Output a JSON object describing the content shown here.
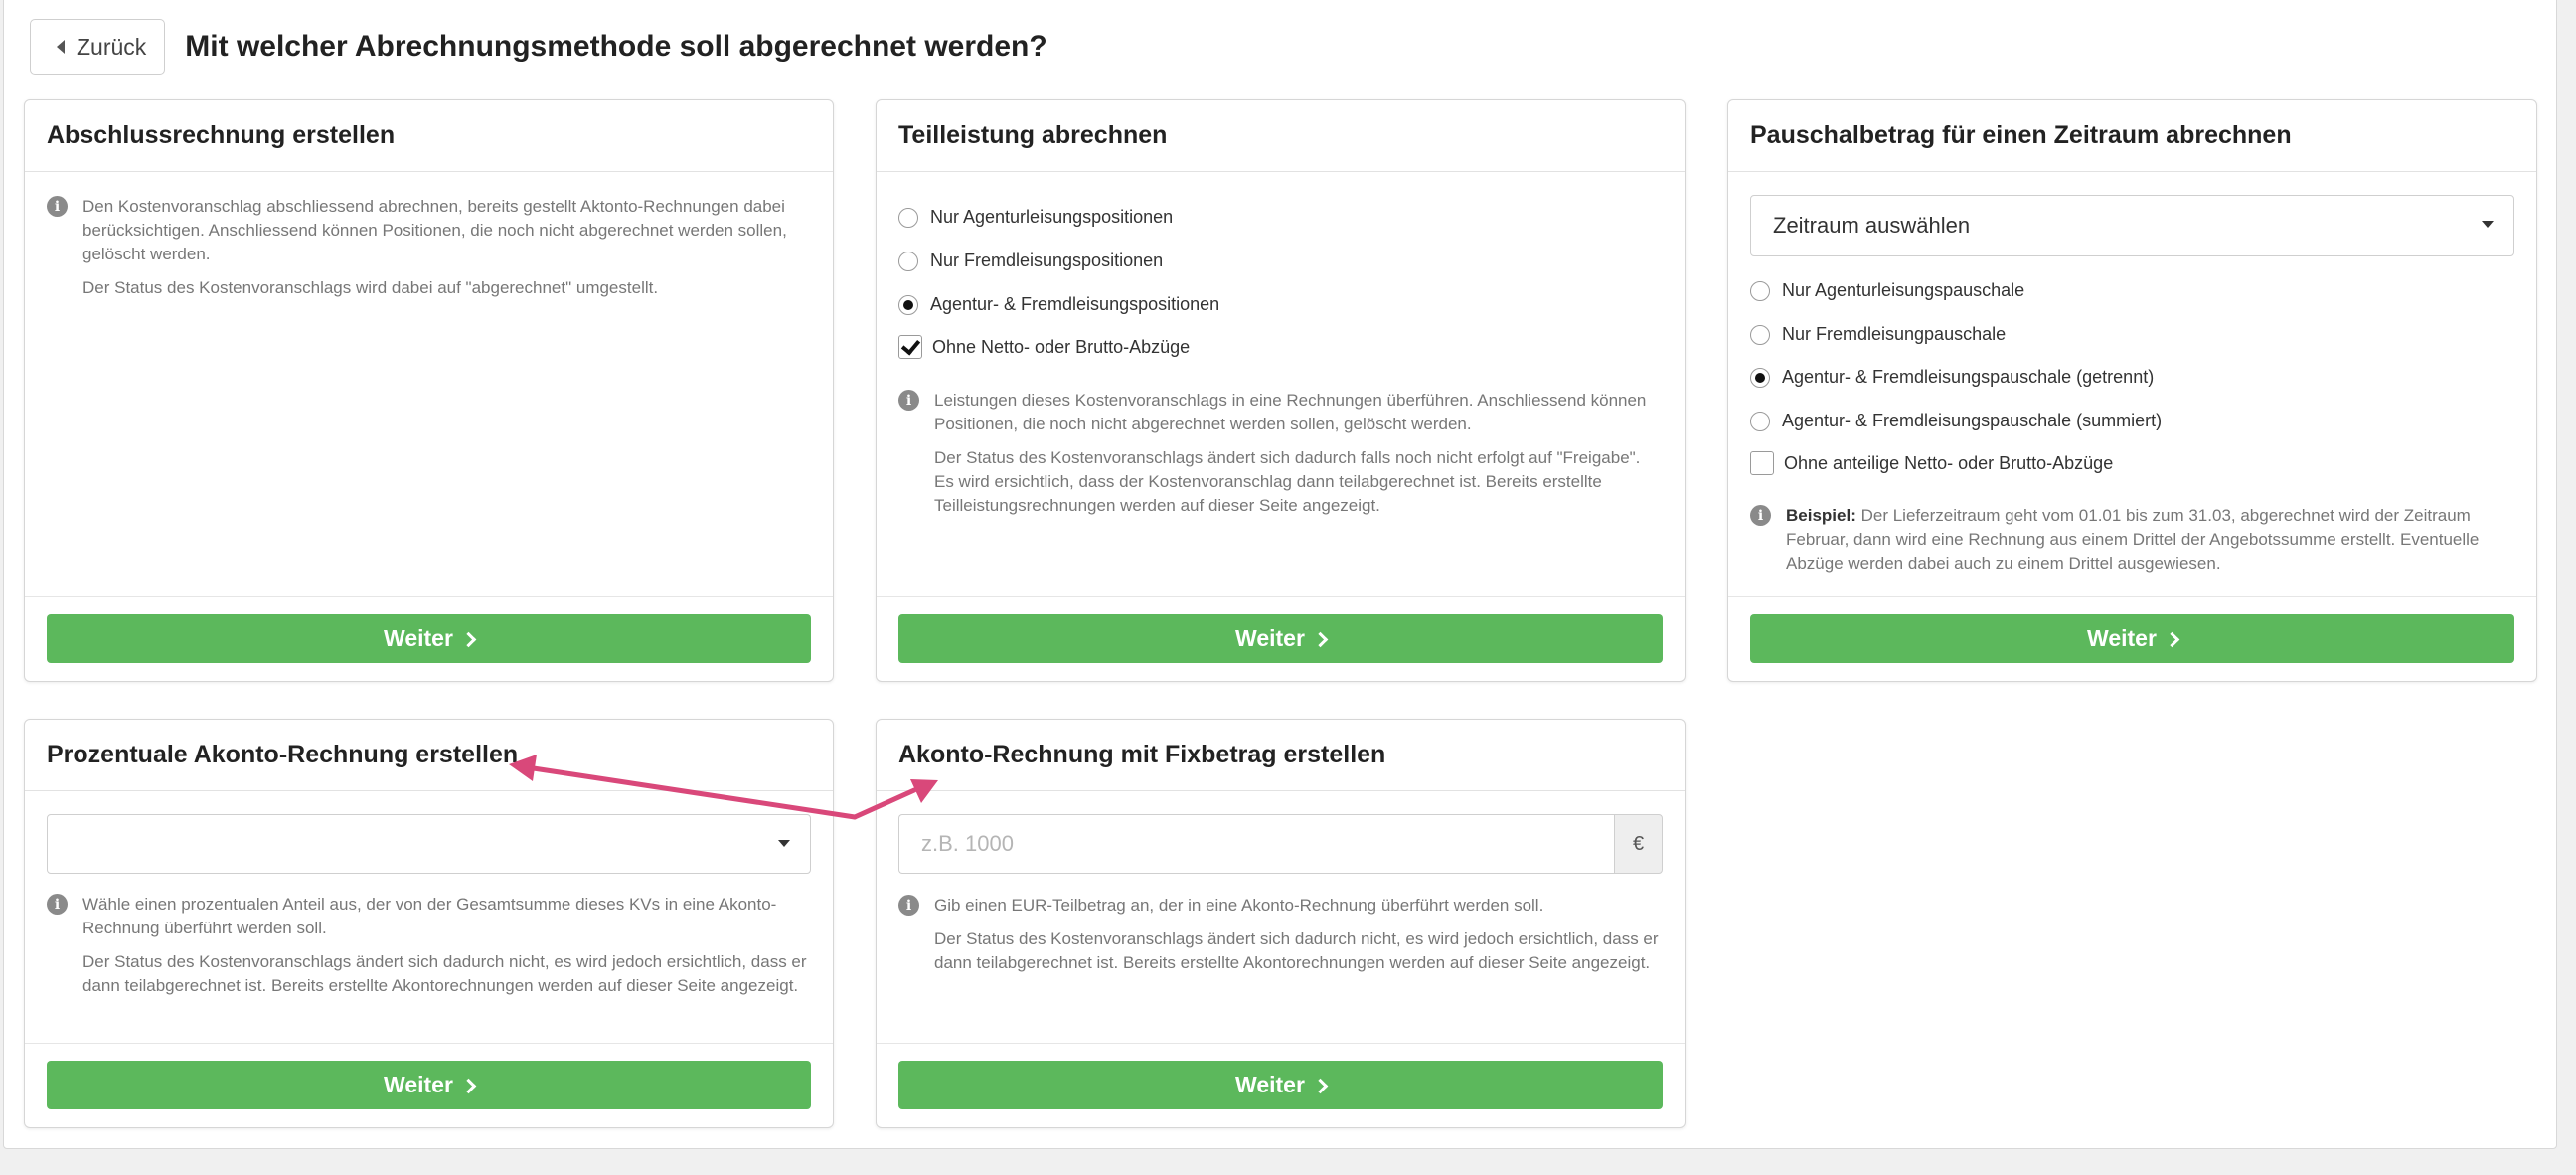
{
  "header": {
    "back_label": "Zurück",
    "title": "Mit welcher Abrechnungsmethode soll abgerechnet werden?"
  },
  "cards": {
    "abschluss": {
      "title": "Abschlussrechnung erstellen",
      "info": [
        "Den Kostenvoranschlag abschliessend abrechnen, bereits gestellt Aktonto-Rechnungen dabei berücksichtigen. Anschliessend können Positionen, die noch nicht abgerechnet werden sollen, gelöscht werden.",
        "Der Status des Kostenvoranschlags wird dabei auf \"abgerechnet\" umgestellt."
      ],
      "button": "Weiter"
    },
    "teilleistung": {
      "title": "Teilleistung abrechnen",
      "options": [
        {
          "label": "Nur Agenturleisungspositionen",
          "selected": false
        },
        {
          "label": "Nur Fremdleisungspositionen",
          "selected": false
        },
        {
          "label": "Agentur- & Fremdleisungspositionen",
          "selected": true
        }
      ],
      "checkbox": {
        "label": "Ohne Netto- oder Brutto-Abzüge",
        "checked": true
      },
      "info": [
        "Leistungen dieses Kostenvoranschlags in eine Rechnungen überführen. Anschliessend können Positionen, die noch nicht abgerechnet werden sollen, gelöscht werden.",
        "Der Status des Kostenvoranschlags ändert sich dadurch falls noch nicht erfolgt auf \"Freigabe\". Es wird ersichtlich, dass der Kostenvoranschlag dann teilabgerechnet ist. Bereits erstellte Teilleistungsrechnungen werden auf dieser Seite angezeigt."
      ],
      "button": "Weiter"
    },
    "pauschal": {
      "title": "Pauschalbetrag für einen Zeitraum abrechnen",
      "select_value": "Zeitraum auswählen",
      "options": [
        {
          "label": "Nur Agenturleisungspauschale",
          "selected": false
        },
        {
          "label": "Nur Fremdleisungpauschale",
          "selected": false
        },
        {
          "label": "Agentur- & Fremdleisungspauschale (getrennt)",
          "selected": true
        },
        {
          "label": "Agentur- & Fremdleisungspauschale (summiert)",
          "selected": false
        }
      ],
      "checkbox": {
        "label": "Ohne anteilige Netto- oder Brutto-Abzüge",
        "checked": false
      },
      "info_bold": "Beispiel:",
      "info": "Der Lieferzeitraum geht vom 01.01 bis zum 31.03, abgerechnet wird der Zeitraum Februar, dann wird eine Rechnung aus einem Drittel der Angebotssumme erstellt. Eventuelle Abzüge werden dabei auch zu einem Drittel ausgewiesen.",
      "button": "Weiter"
    },
    "prozent": {
      "title": "Prozentuale Akonto-Rechnung erstellen",
      "select_value": "",
      "info": [
        "Wähle einen prozentualen Anteil aus, der von der Gesamtsumme dieses KVs in eine Akonto-Rechnung überführt werden soll.",
        "Der Status des Kostenvoranschlags ändert sich dadurch nicht, es wird jedoch ersichtlich, dass er dann teilabgerechnet ist. Bereits erstellte Akontorechnungen werden auf dieser Seite angezeigt."
      ],
      "button": "Weiter"
    },
    "fix": {
      "title": "Akonto-Rechnung mit Fixbetrag erstellen",
      "placeholder": "z.B. 1000",
      "currency": "€",
      "info": [
        "Gib einen EUR-Teilbetrag an, der in eine Akonto-Rechnung überführt werden soll.",
        "Der Status des Kostenvoranschlags ändert sich dadurch nicht, es wird jedoch ersichtlich, dass er dann teilabgerechnet ist. Bereits erstellte Akontorechnungen werden auf dieser Seite angezeigt."
      ],
      "button": "Weiter"
    }
  },
  "annotation": {
    "arrow_color": "#d9487a"
  },
  "colors": {
    "accent_green": "#5cb85c"
  }
}
